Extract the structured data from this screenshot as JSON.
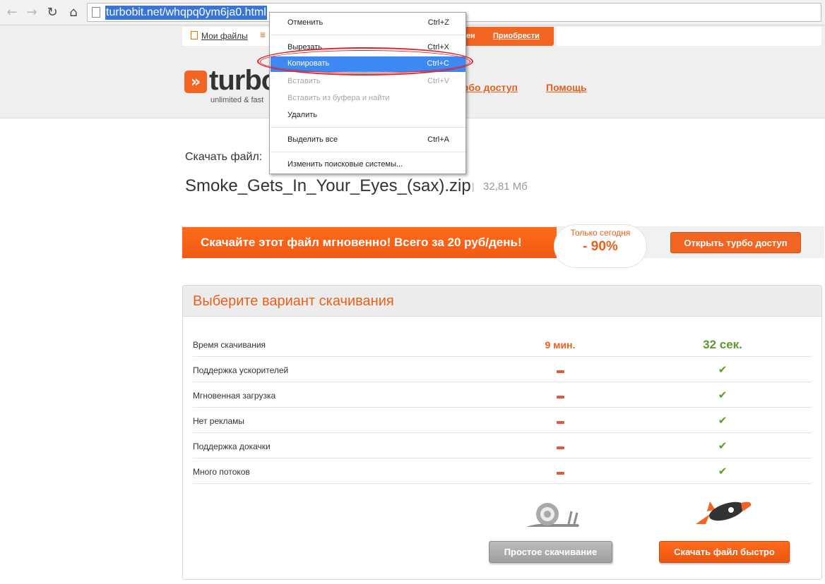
{
  "browser": {
    "url": "turbobit.net/whqpq0ym6ja0.html",
    "nav_icons": [
      "back-icon",
      "forward-icon",
      "reload-icon",
      "home-icon"
    ]
  },
  "header": {
    "my_files_label": "Мои файлы",
    "promo_prefix": "ен",
    "buy_label": "Приобрести",
    "logo_text": "turbo",
    "logo_tagline": "unlimited & fast",
    "nav_turbo": "турбо доступ",
    "nav_help": "Помощь"
  },
  "file": {
    "download_label": "Скачать файл:",
    "name": "Smoke_Gets_In_Your_Eyes_(sax).zip",
    "separator": "|",
    "size": "32,81 Мб"
  },
  "promo": {
    "text": "Скачайте этот файл мгновенно! Всего за 20 руб/день!",
    "today_label": "Только сегодня",
    "discount": "- 90%",
    "open_turbo_button": "Открыть турбо доступ"
  },
  "options": {
    "title": "Выберите вариант скачивания",
    "rows": [
      {
        "label": "Время скачивания",
        "slow": "9 мин.",
        "fast": "32 сек."
      },
      {
        "label": "Поддержка ускорителей",
        "slow": "no",
        "fast": "yes"
      },
      {
        "label": "Мгновенная загрузка",
        "slow": "no",
        "fast": "yes"
      },
      {
        "label": "Нет рекламы",
        "slow": "no",
        "fast": "yes"
      },
      {
        "label": "Поддержка докачки",
        "slow": "no",
        "fast": "yes"
      },
      {
        "label": "Много потоков",
        "slow": "no",
        "fast": "yes"
      }
    ],
    "simple_button": "Простое скачивание",
    "fast_button": "Скачать файл быстро"
  },
  "context_menu": {
    "items": [
      {
        "label": "Отменить",
        "shortcut": "Ctrl+Z",
        "state": "normal"
      },
      {
        "label": "Вырезать",
        "shortcut": "Ctrl+X",
        "state": "normal"
      },
      {
        "label": "Копировать",
        "shortcut": "Ctrl+C",
        "state": "active"
      },
      {
        "label": "Вставить",
        "shortcut": "Ctrl+V",
        "state": "disabled"
      },
      {
        "label": "Вставить из буфера и найти",
        "shortcut": "",
        "state": "disabled"
      },
      {
        "label": "Удалить",
        "shortcut": "",
        "state": "normal"
      },
      {
        "label": "Выделить все",
        "shortcut": "Ctrl+A",
        "state": "normal"
      },
      {
        "label": "Изменить поисковые системы...",
        "shortcut": "",
        "state": "normal"
      }
    ]
  },
  "colors": {
    "brand_orange": "#f26522",
    "selection_blue": "#3875d7",
    "menu_active": "#3d88f3",
    "success_green": "#5e9a2b",
    "annotation_red": "#e2222a"
  }
}
